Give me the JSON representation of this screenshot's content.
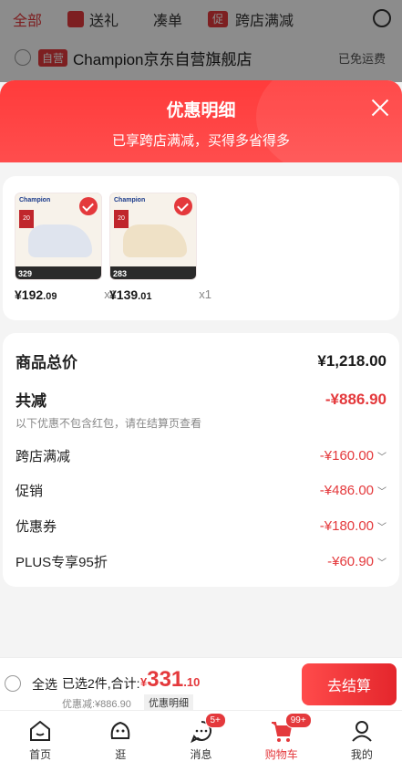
{
  "background": {
    "tabs": [
      {
        "label": "全部",
        "active": true
      },
      {
        "label": "送礼",
        "active": false
      },
      {
        "label": "凑单",
        "active": false
      },
      {
        "label": "跨店满减",
        "active": false
      }
    ],
    "promo_icon_text": "促",
    "store_tag": "自营",
    "store_name": "Champion京东自营旗舰店",
    "free_shipping": "已免运费"
  },
  "sheet": {
    "title": "优惠明细",
    "subtitle": "已享跨店满减，买得多省得多"
  },
  "products": [
    {
      "price_int": "¥192",
      "price_dec": ".09",
      "qty": "x1",
      "strip_price": "329",
      "badge": "20",
      "shoe_color": "#dfe4ee"
    },
    {
      "price_int": "¥139",
      "price_dec": ".01",
      "qty": "x1",
      "strip_price": "283",
      "badge": "20",
      "shoe_color": "#efe1c6"
    }
  ],
  "summary": {
    "total_label": "商品总价",
    "total_value": "¥1,218.00",
    "discount_label": "共减",
    "discount_value": "-¥886.90",
    "note": "以下优惠不包含红包，请在结算页查看",
    "items": [
      {
        "label": "跨店满减",
        "value": "-¥160.00"
      },
      {
        "label": "促销",
        "value": "-¥486.00"
      },
      {
        "label": "优惠券",
        "value": "-¥180.00"
      },
      {
        "label": "PLUS专享95折",
        "value": "-¥60.90"
      }
    ]
  },
  "checkout": {
    "select_all": "全选",
    "selected_text": "已选2件,合计:",
    "currency": "¥",
    "total_int": "331",
    "total_dec": ".10",
    "discount_line": "优惠减:¥886.90",
    "detail_tag": "优惠明细",
    "pay_button": "去结算"
  },
  "tabbar": [
    {
      "label": "首页",
      "icon": "home-icon",
      "badge": ""
    },
    {
      "label": "逛",
      "icon": "face-icon",
      "badge": ""
    },
    {
      "label": "消息",
      "icon": "message-icon",
      "badge": "5+"
    },
    {
      "label": "购物车",
      "icon": "cart-icon",
      "badge": "99+",
      "active": true
    },
    {
      "label": "我的",
      "icon": "user-icon",
      "badge": ""
    }
  ],
  "colors": {
    "accent": "#e4393c"
  }
}
